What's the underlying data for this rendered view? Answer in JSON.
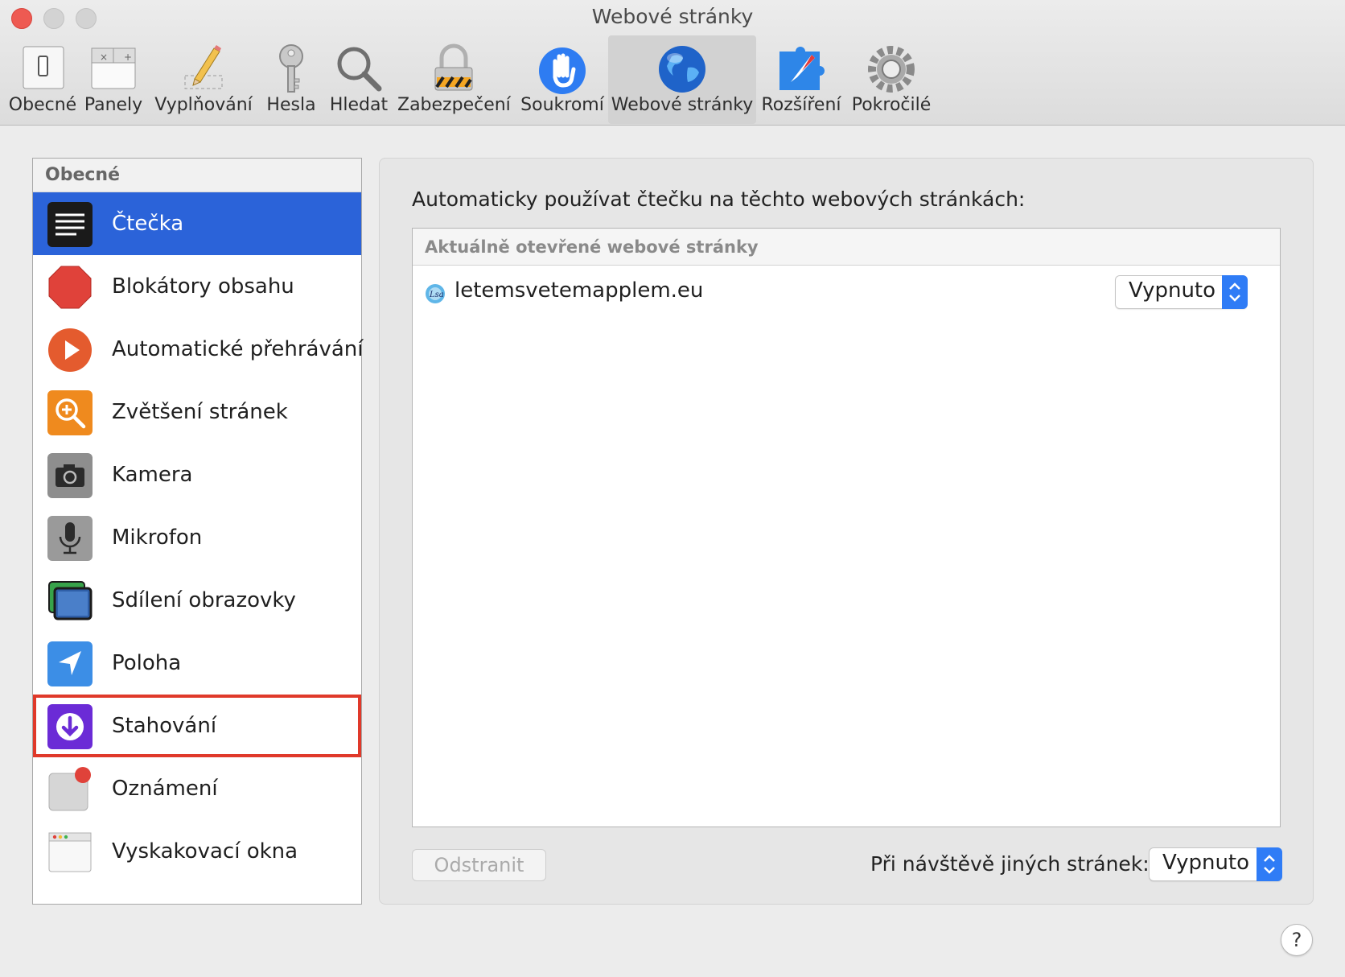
{
  "window": {
    "title": "Webové stránky"
  },
  "toolbar": {
    "items": [
      {
        "label": "Obecné",
        "icon": "switch-icon"
      },
      {
        "label": "Panely",
        "icon": "tabs-icon"
      },
      {
        "label": "Vyplňování",
        "icon": "pencil-icon"
      },
      {
        "label": "Hesla",
        "icon": "key-icon"
      },
      {
        "label": "Hledat",
        "icon": "magnifier-icon"
      },
      {
        "label": "Zabezpečení",
        "icon": "lock-icon"
      },
      {
        "label": "Soukromí",
        "icon": "hand-icon"
      },
      {
        "label": "Webové stránky",
        "icon": "globe-icon",
        "active": true
      },
      {
        "label": "Rozšíření",
        "icon": "puzzle-icon"
      },
      {
        "label": "Pokročilé",
        "icon": "gear-icon"
      }
    ]
  },
  "sidebar": {
    "header": "Obecné",
    "items": [
      {
        "label": "Čtečka",
        "icon": "reader-icon",
        "selected": true
      },
      {
        "label": "Blokátory obsahu",
        "icon": "stop-sign-icon"
      },
      {
        "label": "Automatické přehrávání",
        "icon": "play-icon"
      },
      {
        "label": "Zvětšení stránek",
        "icon": "zoom-icon"
      },
      {
        "label": "Kamera",
        "icon": "camera-icon"
      },
      {
        "label": "Mikrofon",
        "icon": "microphone-icon"
      },
      {
        "label": "Sdílení obrazovky",
        "icon": "screen-share-icon"
      },
      {
        "label": "Poloha",
        "icon": "location-icon"
      },
      {
        "label": "Stahování",
        "icon": "download-icon",
        "highlighted": true
      },
      {
        "label": "Oznámení",
        "icon": "notification-icon"
      },
      {
        "label": "Vyskakovací okna",
        "icon": "popup-window-icon"
      }
    ]
  },
  "main": {
    "heading": "Automaticky používat čtečku na těchto webových stránkách:",
    "list_header": "Aktuálně otevřené webové stránky",
    "sites": [
      {
        "name": "letemsvetemapplem.eu",
        "setting": "Vypnuto"
      }
    ],
    "remove_label": "Odstranit",
    "other_sites_label": "Při návštěvě jiných stránek:",
    "other_sites_value": "Vypnuto"
  },
  "help_label": "?",
  "colors": {
    "selection": "#2b63d9",
    "highlight_border": "#e0392a",
    "popup_accent": "#2f7cf6"
  }
}
